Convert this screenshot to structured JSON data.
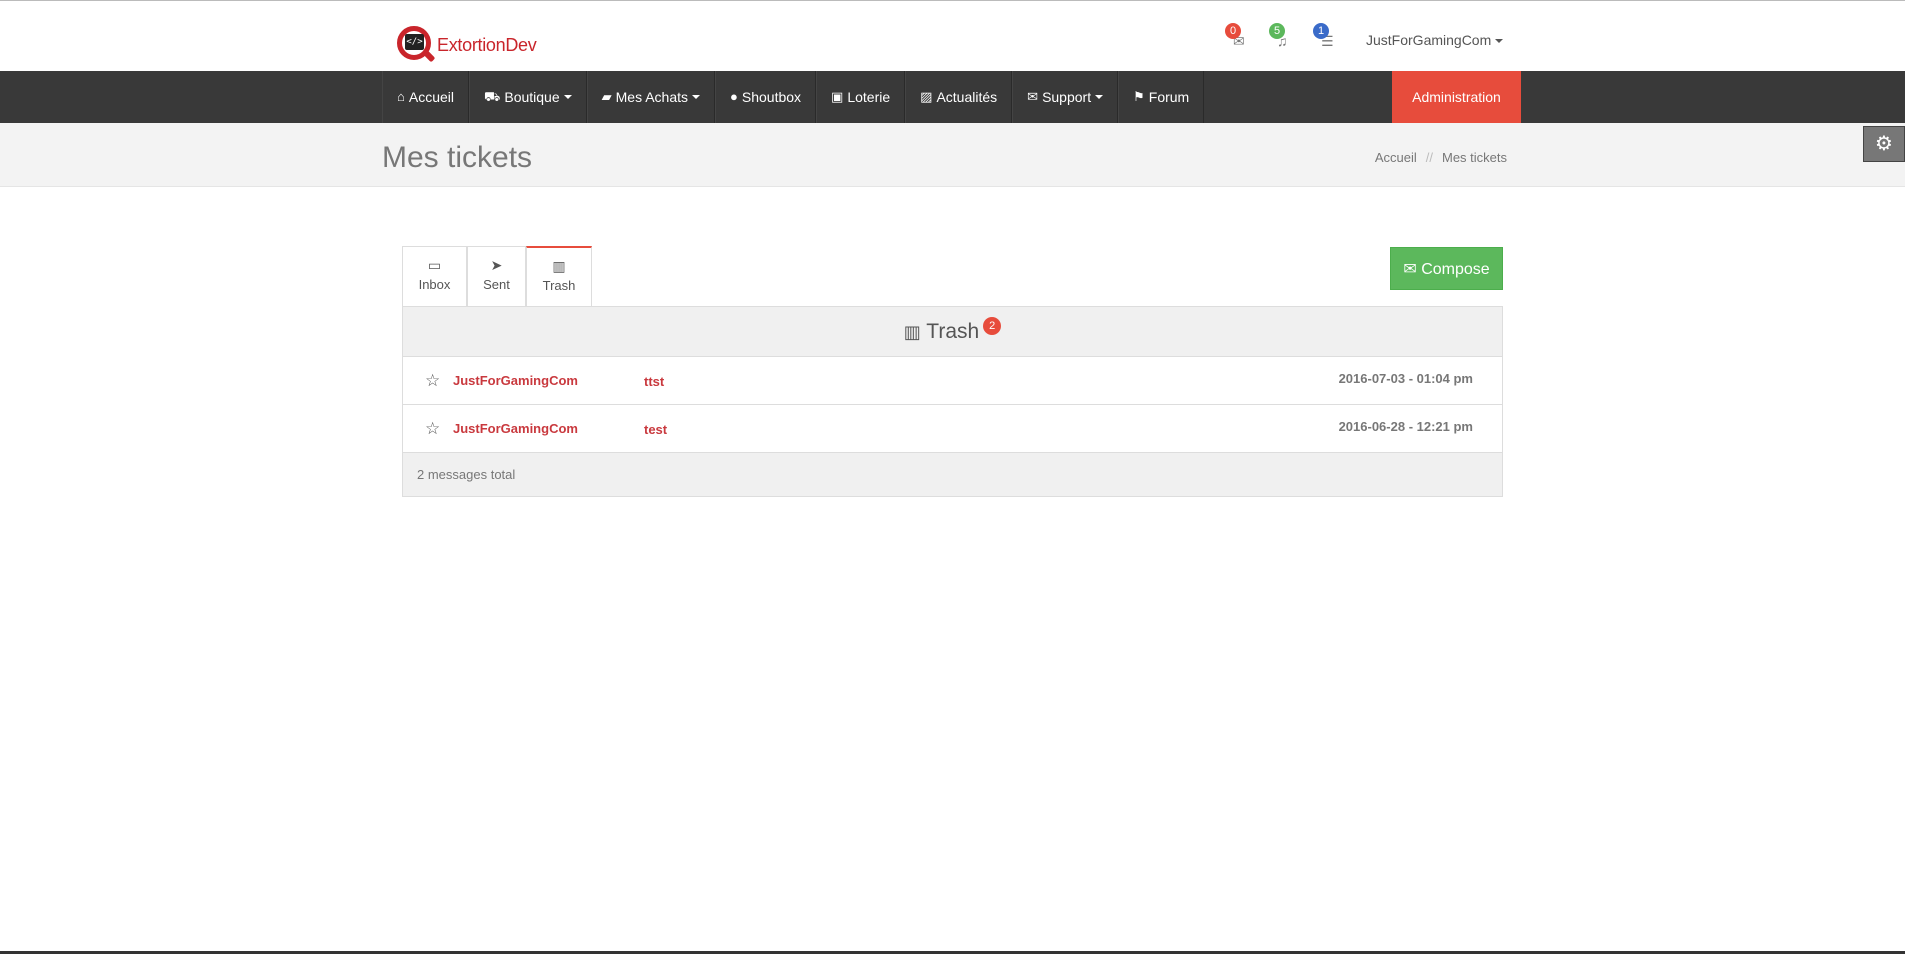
{
  "brand": {
    "name": "ExtortionDev",
    "logo_mark": "</>"
  },
  "notifications": [
    {
      "icon": "envelope-icon",
      "glyph": "✉",
      "count": "0",
      "color": "#e74c3c"
    },
    {
      "icon": "bell-icon",
      "glyph": "🔔",
      "count": "5",
      "color": "#5cb85c"
    },
    {
      "icon": "list-icon",
      "glyph": "☰",
      "count": "1",
      "color": "#3a6bc9"
    }
  ],
  "user": {
    "name": "JustForGamingCom"
  },
  "nav": {
    "items": [
      {
        "label": "Accueil",
        "icon": "home-icon",
        "glyph": "⌂",
        "dropdown": false
      },
      {
        "label": "Boutique",
        "icon": "cart-icon",
        "glyph": "🛒",
        "dropdown": true
      },
      {
        "label": "Mes Achats",
        "icon": "book-icon",
        "glyph": "📘",
        "dropdown": true
      },
      {
        "label": "Shoutbox",
        "icon": "comments-icon",
        "glyph": "💬",
        "dropdown": false
      },
      {
        "label": "Loterie",
        "icon": "gift-icon",
        "glyph": "🎁",
        "dropdown": false
      },
      {
        "label": "Actualités",
        "icon": "image-icon",
        "glyph": "🖼",
        "dropdown": false
      },
      {
        "label": "Support",
        "icon": "envelope-icon",
        "glyph": "✉",
        "dropdown": true
      },
      {
        "label": "Forum",
        "icon": "flag-icon",
        "glyph": "⚑",
        "dropdown": false
      }
    ],
    "admin_label": "Administration"
  },
  "page": {
    "title": "Mes tickets",
    "breadcrumb": [
      "Accueil",
      "Mes tickets"
    ],
    "breadcrumb_sep": "//"
  },
  "mailbox": {
    "tabs": [
      {
        "label": "Inbox",
        "icon": "inbox-icon",
        "glyph": "⎙"
      },
      {
        "label": "Sent",
        "icon": "send-icon",
        "glyph": "➤"
      },
      {
        "label": "Trash",
        "icon": "trash-icon",
        "glyph": "🗑"
      }
    ],
    "active_tab": "Trash",
    "compose_label": "Compose",
    "folder_title": "Trash",
    "folder_count": "2",
    "messages": [
      {
        "from": "JustForGamingCom",
        "subject": "ttst",
        "date": "2016-07-03 - 01:04 pm"
      },
      {
        "from": "JustForGamingCom",
        "subject": "test",
        "date": "2016-06-28 - 12:21 pm"
      }
    ],
    "footer": "2 messages total"
  }
}
